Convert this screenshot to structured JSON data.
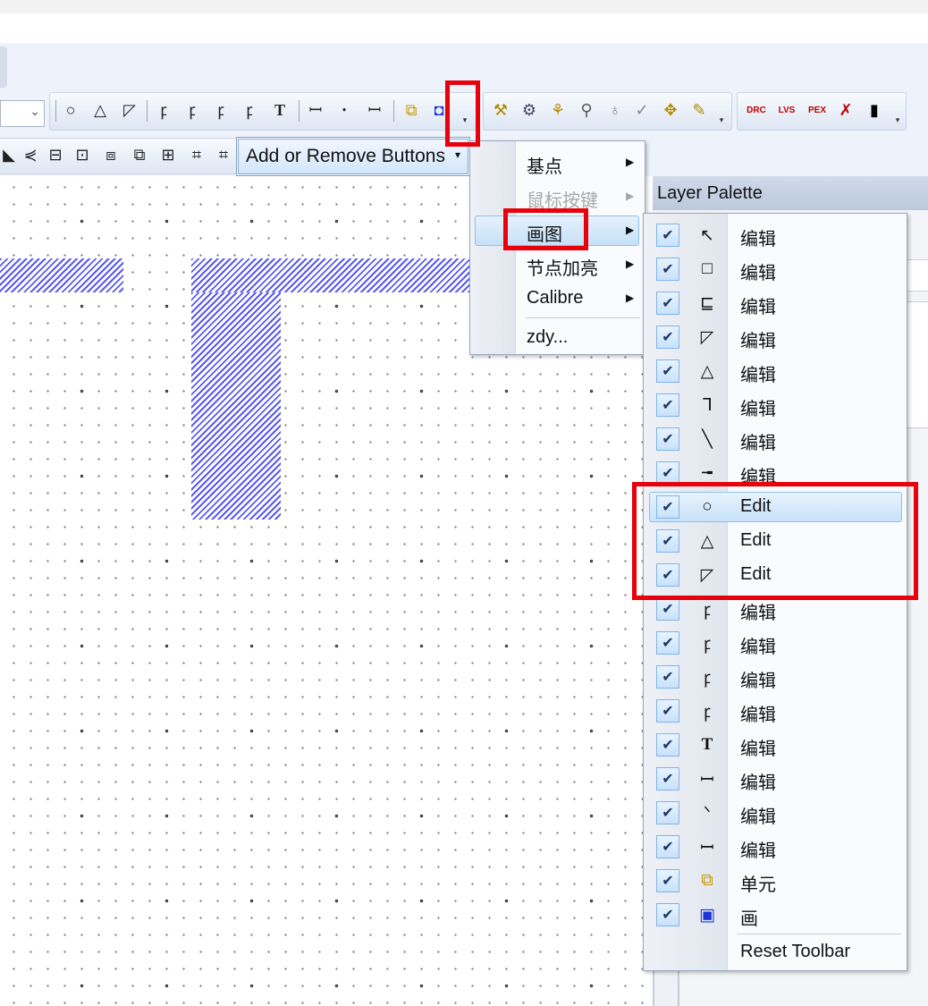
{
  "toolbar_drawing": {
    "icons": [
      "circle-icon",
      "triangle-icon",
      "slanted-shape-icon",
      "pb1-icon",
      "pb2-icon",
      "pb3-icon",
      "pb4-icon",
      "text-icon",
      "ruler1-icon",
      "ruler2-icon",
      "ruler3-icon",
      "instance-icon",
      "square-dot-icon"
    ],
    "glyphs": [
      "○",
      "△",
      "◸",
      "ꝼ",
      "ꝼ",
      "ꝼ",
      "ꝼ",
      "T",
      "ꟷ",
      "ꞏ",
      "ꟷ",
      "⧉",
      "◘"
    ]
  },
  "dropdown": {
    "label": "Add or Remove Buttons"
  },
  "submenu1": {
    "items": [
      {
        "label": "基点",
        "disabled": false
      },
      {
        "label": "鼠标按键",
        "disabled": true
      },
      {
        "label": "画图",
        "disabled": false,
        "highlighted": true
      },
      {
        "label": "节点加亮",
        "disabled": false
      },
      {
        "label": "Calibre",
        "disabled": false
      },
      {
        "label": "zdy...",
        "disabled": false
      }
    ],
    "submenu_arrow": "▶"
  },
  "layer_palette": {
    "title": "Layer Palette"
  },
  "submenu2": {
    "items": [
      {
        "icon": "pointer-icon",
        "glyph": "↖",
        "label": "编辑"
      },
      {
        "icon": "rectangle-icon",
        "glyph": "□",
        "label": "编辑"
      },
      {
        "icon": "polygon-icon",
        "glyph": "⊑",
        "label": "编辑"
      },
      {
        "icon": "slanted-polygon-icon",
        "glyph": "◸",
        "label": "编辑"
      },
      {
        "icon": "triangle-icon",
        "glyph": "△",
        "label": "编辑"
      },
      {
        "icon": "path-icon",
        "glyph": "ᒣ",
        "label": "编辑"
      },
      {
        "icon": "diagonal-line-icon",
        "glyph": "╲",
        "label": "编辑"
      },
      {
        "icon": "short-line-icon",
        "glyph": "╼",
        "label": "编辑"
      },
      {
        "icon": "circle-icon",
        "glyph": "○",
        "label": "Edit",
        "highlighted": true
      },
      {
        "icon": "triangle-outline-icon",
        "glyph": "△",
        "label": "Edit"
      },
      {
        "icon": "slanted-shape-icon",
        "glyph": "◸",
        "label": "Edit"
      },
      {
        "icon": "pb1-icon",
        "glyph": "ꝼ",
        "label": "编辑"
      },
      {
        "icon": "pb2-icon",
        "glyph": "ꝼ",
        "label": "编辑"
      },
      {
        "icon": "pb3-icon",
        "glyph": "ꝼ",
        "label": "编辑"
      },
      {
        "icon": "pb4-icon",
        "glyph": "ꝼ",
        "label": "编辑"
      },
      {
        "icon": "text-icon",
        "glyph": "T",
        "label": "编辑"
      },
      {
        "icon": "ruler1-icon",
        "glyph": "ꟷ",
        "label": "编辑"
      },
      {
        "icon": "ruler2-icon",
        "glyph": "ᐠ",
        "label": "编辑"
      },
      {
        "icon": "ruler3-icon",
        "glyph": "ꟷ",
        "label": "编辑"
      },
      {
        "icon": "instance-icon",
        "glyph": "⧉",
        "label": "单元"
      },
      {
        "icon": "square-dot-icon",
        "glyph": "▣",
        "label": "画"
      }
    ],
    "check": "✔",
    "reset": "Reset Toolbar"
  },
  "toolbar_misc": {
    "glyphs": [
      "▾",
      "▾",
      "▾",
      "▾"
    ],
    "calibre_labels": [
      "DRC",
      "LVS",
      "PEX"
    ]
  },
  "colors": {
    "accent_red": "#e8000b",
    "hatch": "#5a5af0",
    "highlight": "#c8e2f9"
  }
}
